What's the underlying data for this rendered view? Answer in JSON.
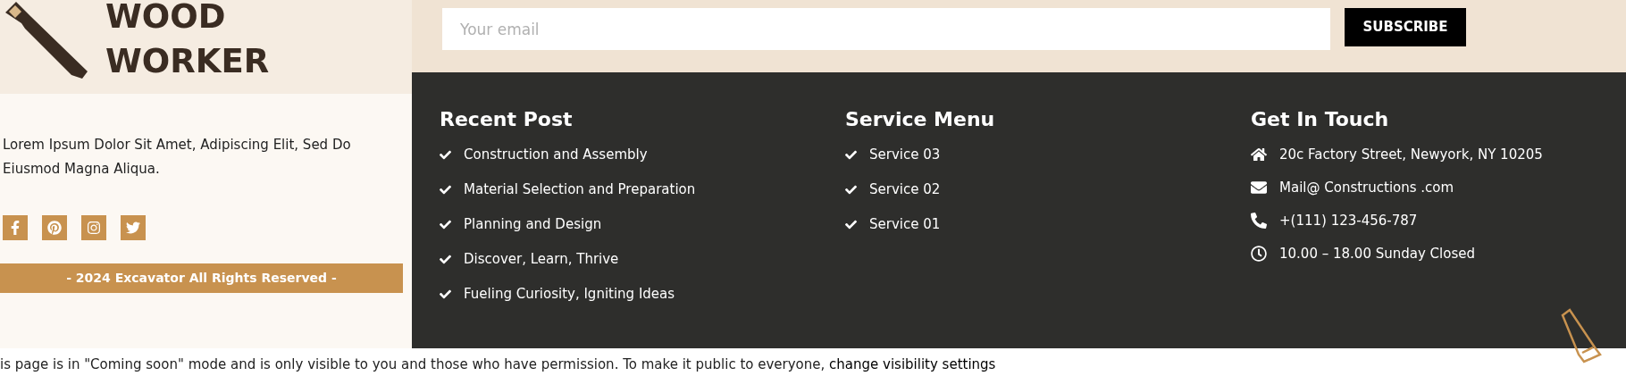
{
  "brand": {
    "title_lines": [
      "WOOD",
      "WORKER"
    ]
  },
  "about": {
    "text": "Lorem Ipsum Dolor Sit Amet, Adipiscing Elit, Sed Do Eiusmod Magna Aliqua."
  },
  "social_links": [
    {
      "kind": "facebook"
    },
    {
      "kind": "pinterest"
    },
    {
      "kind": "instagram"
    },
    {
      "kind": "twitter"
    }
  ],
  "copyright": "- 2024 Excavator All Rights Reserved -",
  "newsletter": {
    "placeholder": "Your email",
    "button": "SUBSCRIBE"
  },
  "columns": [
    {
      "title": "Recent Post",
      "items": [
        "Construction and Assembly",
        "Material Selection and Preparation",
        "Planning and Design",
        "Discover, Learn, Thrive",
        "Fueling Curiosity, Igniting Ideas"
      ]
    },
    {
      "title": "Service Menu",
      "items": [
        "Service 03",
        "Service 02",
        "Service 01"
      ]
    }
  ],
  "contact": {
    "title": "Get In Touch",
    "items": [
      {
        "kind": "address",
        "text": "20c Factory Street, Newyork, NY 10205"
      },
      {
        "kind": "email",
        "text": "Mail@ Constructions .com"
      },
      {
        "kind": "phone",
        "text": "+(111) 123-456-787"
      },
      {
        "kind": "hours",
        "text": "10.00 – 18.00 Sunday Closed"
      }
    ]
  },
  "notice": {
    "text": "is page is in \"Coming soon\" mode and is only visible to you and those who have permission. To make it public to everyone,",
    "link": "change visibility settings"
  }
}
